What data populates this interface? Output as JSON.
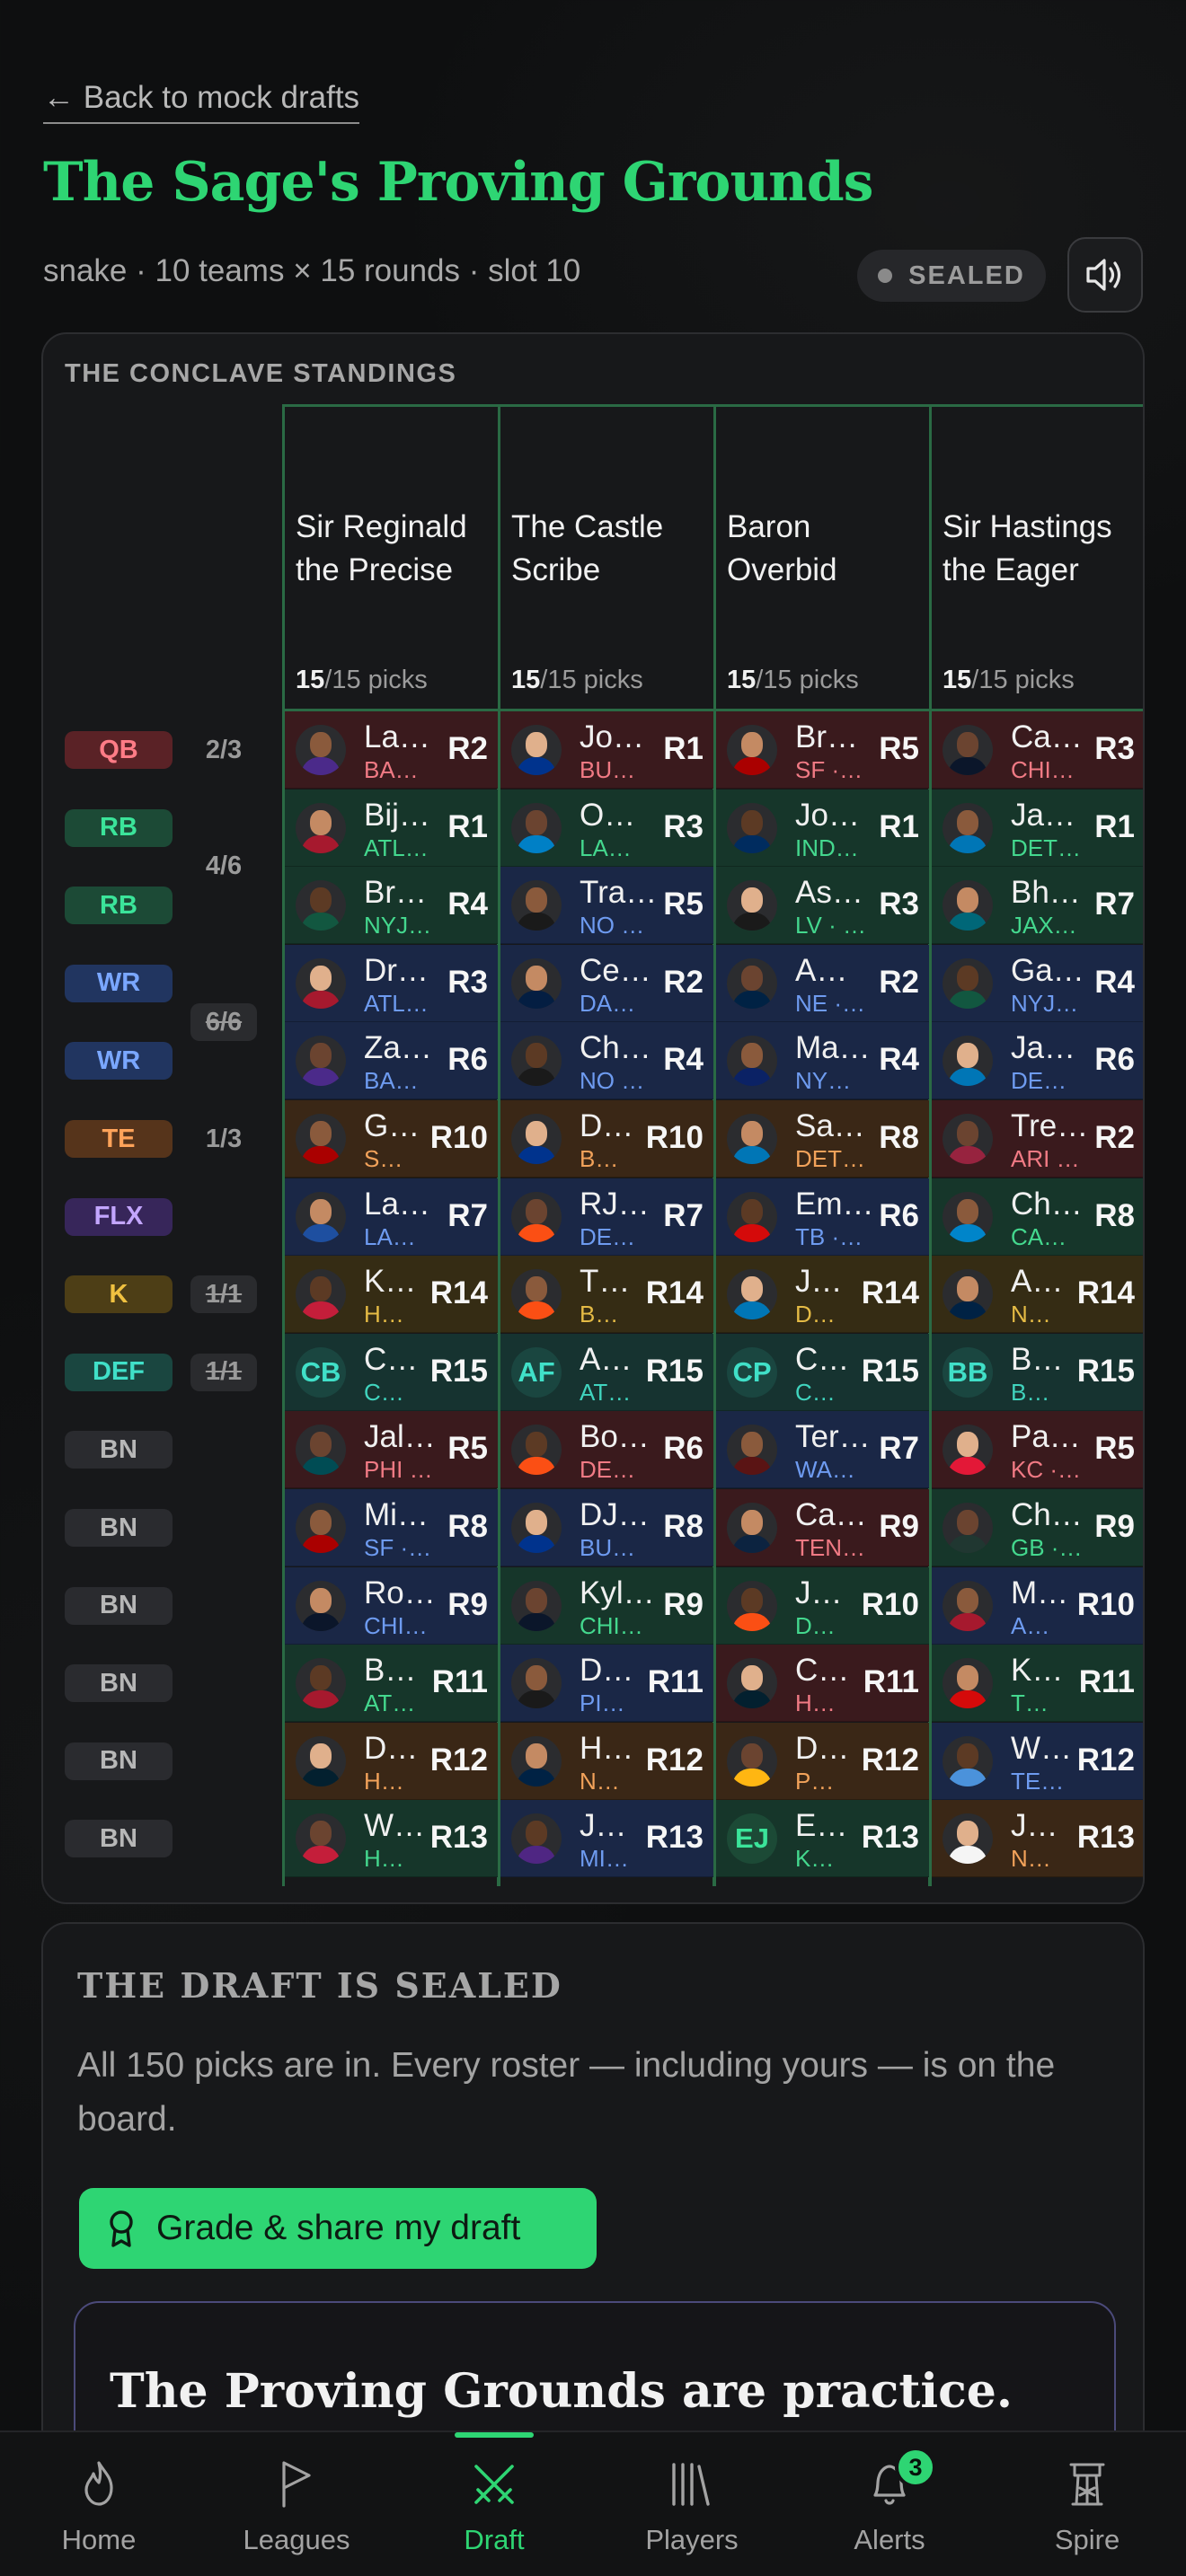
{
  "header": {
    "back_link": "← Back to mock drafts",
    "title": "The Sage's Proving Grounds",
    "subtitle": "snake · 10 teams × 15 rounds · slot 10",
    "status_badge": "SEALED"
  },
  "board": {
    "label": "THE CONCLAVE STANDINGS",
    "slots": [
      {
        "pos": "QB",
        "count": "2/3",
        "count_done": false,
        "count_offset": 0
      },
      {
        "pos": "RB",
        "count": "4/6",
        "count_done": false,
        "count_offset": 0.5
      },
      {
        "pos": "RB",
        "count": "",
        "count_done": false,
        "count_offset": 0
      },
      {
        "pos": "WR",
        "count": "6/6",
        "count_done": true,
        "count_offset": 0.5
      },
      {
        "pos": "WR",
        "count": "",
        "count_done": false,
        "count_offset": 0
      },
      {
        "pos": "TE",
        "count": "1/3",
        "count_done": false,
        "count_offset": 0
      },
      {
        "pos": "FLX",
        "count": "",
        "count_done": false,
        "count_offset": 0
      },
      {
        "pos": "K",
        "count": "1/1",
        "count_done": true,
        "count_offset": 0
      },
      {
        "pos": "DEF",
        "count": "1/1",
        "count_done": true,
        "count_offset": 0
      },
      {
        "pos": "BN",
        "count": "",
        "count_done": false,
        "count_offset": 0
      },
      {
        "pos": "BN",
        "count": "",
        "count_done": false,
        "count_offset": 0
      },
      {
        "pos": "BN",
        "count": "",
        "count_done": false,
        "count_offset": 0
      },
      {
        "pos": "BN",
        "count": "",
        "count_done": false,
        "count_offset": 0
      },
      {
        "pos": "BN",
        "count": "",
        "count_done": false,
        "count_offset": 0
      },
      {
        "pos": "BN",
        "count": "",
        "count_done": false,
        "count_offset": 0
      }
    ],
    "teams": [
      {
        "name_line1": "Sir Reginald",
        "name_line2": "the Precise",
        "picks_made": "15",
        "picks_total": "/15 picks",
        "picks": [
          {
            "name": "La…",
            "team": "BA…",
            "round": "R2",
            "pos": "QB",
            "jersey": "#4b2a8a"
          },
          {
            "name": "Bij…",
            "team": "ATL…",
            "round": "R1",
            "pos": "RB",
            "jersey": "#a6192e"
          },
          {
            "name": "Br…",
            "team": "NYJ…",
            "round": "R4",
            "pos": "RB",
            "jersey": "#125740"
          },
          {
            "name": "Dr…",
            "team": "ATL…",
            "round": "R3",
            "pos": "WR",
            "jersey": "#a6192e"
          },
          {
            "name": "Za…",
            "team": "BA…",
            "round": "R6",
            "pos": "WR",
            "jersey": "#4b2a8a"
          },
          {
            "name": "G…",
            "team": "S…",
            "round": "R10",
            "pos": "TE",
            "jersey": "#aa0000"
          },
          {
            "name": "La…",
            "team": "LA…",
            "round": "R7",
            "pos": "WR",
            "jersey": "#1e4fa0"
          },
          {
            "name": "K…",
            "team": "H…",
            "round": "R14",
            "pos": "K",
            "jersey": "#c41e3a"
          },
          {
            "name": "C…",
            "team": "C…",
            "round": "R15",
            "pos": "DEF",
            "def_abbr": "CB"
          },
          {
            "name": "Jal…",
            "team": "PHI …",
            "round": "R5",
            "pos": "QB",
            "jersey": "#004c54"
          },
          {
            "name": "Mi…",
            "team": "SF ·…",
            "round": "R8",
            "pos": "WR",
            "jersey": "#aa0000"
          },
          {
            "name": "Ro…",
            "team": "CHI…",
            "round": "R9",
            "pos": "WR",
            "jersey": "#0b162a"
          },
          {
            "name": "B…",
            "team": "AT…",
            "round": "R11",
            "pos": "RB",
            "jersey": "#a6192e"
          },
          {
            "name": "D…",
            "team": "H…",
            "round": "R12",
            "pos": "TE",
            "jersey": "#03202f"
          },
          {
            "name": "W…",
            "team": "H…",
            "round": "R13",
            "pos": "RB",
            "jersey": "#c41e3a"
          }
        ]
      },
      {
        "name_line1": "The Castle",
        "name_line2": "Scribe",
        "picks_made": "15",
        "picks_total": "/15 picks",
        "picks": [
          {
            "name": "Jo…",
            "team": "BU…",
            "round": "R1",
            "pos": "QB",
            "jersey": "#00338d"
          },
          {
            "name": "O…",
            "team": "LA…",
            "round": "R3",
            "pos": "RB",
            "jersey": "#0080c6"
          },
          {
            "name": "Tra…",
            "team": "NO …",
            "round": "R5",
            "pos": "WR",
            "jersey": "#1a1a1a"
          },
          {
            "name": "Ce…",
            "team": "DA…",
            "round": "R2",
            "pos": "WR",
            "jersey": "#041e42"
          },
          {
            "name": "Ch…",
            "team": "NO …",
            "round": "R4",
            "pos": "WR",
            "jersey": "#1a1a1a"
          },
          {
            "name": "D…",
            "team": "B…",
            "round": "R10",
            "pos": "TE",
            "jersey": "#00338d"
          },
          {
            "name": "RJ…",
            "team": "DE…",
            "round": "R7",
            "pos": "WR",
            "jersey": "#fb4f14"
          },
          {
            "name": "T…",
            "team": "B…",
            "round": "R14",
            "pos": "K",
            "jersey": "#fb4f14"
          },
          {
            "name": "A…",
            "team": "AT…",
            "round": "R15",
            "pos": "DEF",
            "def_abbr": "AF"
          },
          {
            "name": "Bo…",
            "team": "DE…",
            "round": "R6",
            "pos": "QB",
            "jersey": "#fb4f14"
          },
          {
            "name": "DJ…",
            "team": "BU…",
            "round": "R8",
            "pos": "WR",
            "jersey": "#00338d"
          },
          {
            "name": "Kyl…",
            "team": "CHI…",
            "round": "R9",
            "pos": "RB",
            "jersey": "#0b162a"
          },
          {
            "name": "D…",
            "team": "PI…",
            "round": "R11",
            "pos": "WR",
            "jersey": "#1a1a1a"
          },
          {
            "name": "H…",
            "team": "N…",
            "round": "R12",
            "pos": "TE",
            "jersey": "#002244"
          },
          {
            "name": "J…",
            "team": "MI…",
            "round": "R13",
            "pos": "WR",
            "jersey": "#4f2683"
          }
        ]
      },
      {
        "name_line1": "Baron",
        "name_line2": "Overbid",
        "picks_made": "15",
        "picks_total": "/15 picks",
        "picks": [
          {
            "name": "Br…",
            "team": "SF ·…",
            "round": "R5",
            "pos": "QB",
            "jersey": "#aa0000"
          },
          {
            "name": "Jo…",
            "team": "IND…",
            "round": "R1",
            "pos": "RB",
            "jersey": "#002c5f"
          },
          {
            "name": "As…",
            "team": "LV · …",
            "round": "R3",
            "pos": "RB",
            "jersey": "#1a1a1a"
          },
          {
            "name": "A…",
            "team": "NE ·…",
            "round": "R2",
            "pos": "WR",
            "jersey": "#002244"
          },
          {
            "name": "Ma…",
            "team": "NY…",
            "round": "R4",
            "pos": "WR",
            "jersey": "#0b2265"
          },
          {
            "name": "Sa…",
            "team": "DET…",
            "round": "R8",
            "pos": "TE",
            "jersey": "#0076b6"
          },
          {
            "name": "Em…",
            "team": "TB ·…",
            "round": "R6",
            "pos": "WR",
            "jersey": "#d50a0a"
          },
          {
            "name": "J…",
            "team": "D…",
            "round": "R14",
            "pos": "K",
            "jersey": "#0076b6"
          },
          {
            "name": "C…",
            "team": "C…",
            "round": "R15",
            "pos": "DEF",
            "def_abbr": "CP"
          },
          {
            "name": "Ter…",
            "team": "WA…",
            "round": "R7",
            "pos": "WR",
            "jersey": "#5a1414"
          },
          {
            "name": "Ca…",
            "team": "TEN…",
            "round": "R9",
            "pos": "QB",
            "jersey": "#0c2340"
          },
          {
            "name": "J…",
            "team": "D…",
            "round": "R10",
            "pos": "RB",
            "jersey": "#fb4f14"
          },
          {
            "name": "C…",
            "team": "H…",
            "round": "R11",
            "pos": "QB",
            "jersey": "#03202f"
          },
          {
            "name": "D…",
            "team": "P…",
            "round": "R12",
            "pos": "TE",
            "jersey": "#ffb612"
          },
          {
            "name": "E…",
            "team": "K…",
            "round": "R13",
            "pos": "RB",
            "def_abbr": "EJ"
          }
        ]
      },
      {
        "name_line1": "Sir Hastings",
        "name_line2": "the Eager",
        "picks_made": "15",
        "picks_total": "/15 picks",
        "picks": [
          {
            "name": "Ca…",
            "team": "CHI…",
            "round": "R3",
            "pos": "QB",
            "jersey": "#0b162a"
          },
          {
            "name": "Ja…",
            "team": "DET…",
            "round": "R1",
            "pos": "RB",
            "jersey": "#0076b6"
          },
          {
            "name": "Bh…",
            "team": "JAX…",
            "round": "R7",
            "pos": "RB",
            "jersey": "#006778"
          },
          {
            "name": "Ga…",
            "team": "NYJ…",
            "round": "R4",
            "pos": "WR",
            "jersey": "#125740"
          },
          {
            "name": "Ja…",
            "team": "DE…",
            "round": "R6",
            "pos": "WR",
            "jersey": "#0076b6"
          },
          {
            "name": "Tre…",
            "team": "ARI …",
            "round": "R2",
            "pos": "QB",
            "jersey": "#97233f"
          },
          {
            "name": "Ch…",
            "team": "CA…",
            "round": "R8",
            "pos": "RB",
            "jersey": "#0085ca"
          },
          {
            "name": "A…",
            "team": "N…",
            "round": "R14",
            "pos": "K",
            "jersey": "#002244"
          },
          {
            "name": "B…",
            "team": "B…",
            "round": "R15",
            "pos": "DEF",
            "def_abbr": "BB"
          },
          {
            "name": "Pa…",
            "team": "KC ·…",
            "round": "R5",
            "pos": "QB",
            "jersey": "#e31837"
          },
          {
            "name": "Ch…",
            "team": "GB ·…",
            "round": "R9",
            "pos": "RB",
            "jersey": "#203731"
          },
          {
            "name": "M…",
            "team": "A…",
            "round": "R10",
            "pos": "WR",
            "jersey": "#a6192e"
          },
          {
            "name": "K…",
            "team": "T…",
            "round": "R11",
            "pos": "RB",
            "jersey": "#d50a0a"
          },
          {
            "name": "W…",
            "team": "TE…",
            "round": "R12",
            "pos": "WR",
            "jersey": "#4b92db"
          },
          {
            "name": "J…",
            "team": "N…",
            "round": "R13",
            "pos": "TE",
            "jersey": "#f5f5f5"
          }
        ]
      }
    ]
  },
  "sealed": {
    "heading": "THE DRAFT IS SEALED",
    "text": "All 150 picks are in. Every roster — including yours — is on the board.",
    "button": "Grade & share my draft",
    "practice_title": "The Proving Grounds are practice."
  },
  "tabs": [
    {
      "label": "Home",
      "icon": "flame-icon",
      "active": false
    },
    {
      "label": "Leagues",
      "icon": "flag-icon",
      "active": false
    },
    {
      "label": "Draft",
      "icon": "crossed-swords-icon",
      "active": true
    },
    {
      "label": "Players",
      "icon": "library-icon",
      "active": false
    },
    {
      "label": "Alerts",
      "icon": "bell-icon",
      "active": false,
      "badge": "3"
    },
    {
      "label": "Spire",
      "icon": "tower-icon",
      "active": false
    }
  ],
  "colors": {
    "accent": "#2ed573",
    "QB": {
      "bg": "#3a1a1d",
      "badge": "#5a2226",
      "text": "#ff7c86",
      "team": "#f07a84"
    },
    "RB": {
      "bg": "#16362a",
      "badge": "#1c4a36",
      "text": "#3be49a",
      "team": "#44d88e"
    },
    "WR": {
      "bg": "#1a2746",
      "badge": "#213560",
      "text": "#7aa7ff",
      "team": "#6e9bf0"
    },
    "TE": {
      "bg": "#3a2716",
      "badge": "#56341b",
      "text": "#ffa35a",
      "team": "#f2a25a"
    },
    "FLX": {
      "bg": "#2a1f44",
      "badge": "#37265a",
      "text": "#c3a6ff",
      "team": "#c3a6ff"
    },
    "K": {
      "bg": "#352c14",
      "badge": "#4d3e16",
      "text": "#f0c140",
      "team": "#e5bb45"
    },
    "DEF": {
      "bg": "#163330",
      "badge": "#1a4640",
      "text": "#40e0c8",
      "team": "#40d4be"
    },
    "BN": {
      "bg": "#1e1f22",
      "badge": "#2a2b2f",
      "text": "#b7b7b7",
      "team": "#9a9a9a"
    }
  }
}
